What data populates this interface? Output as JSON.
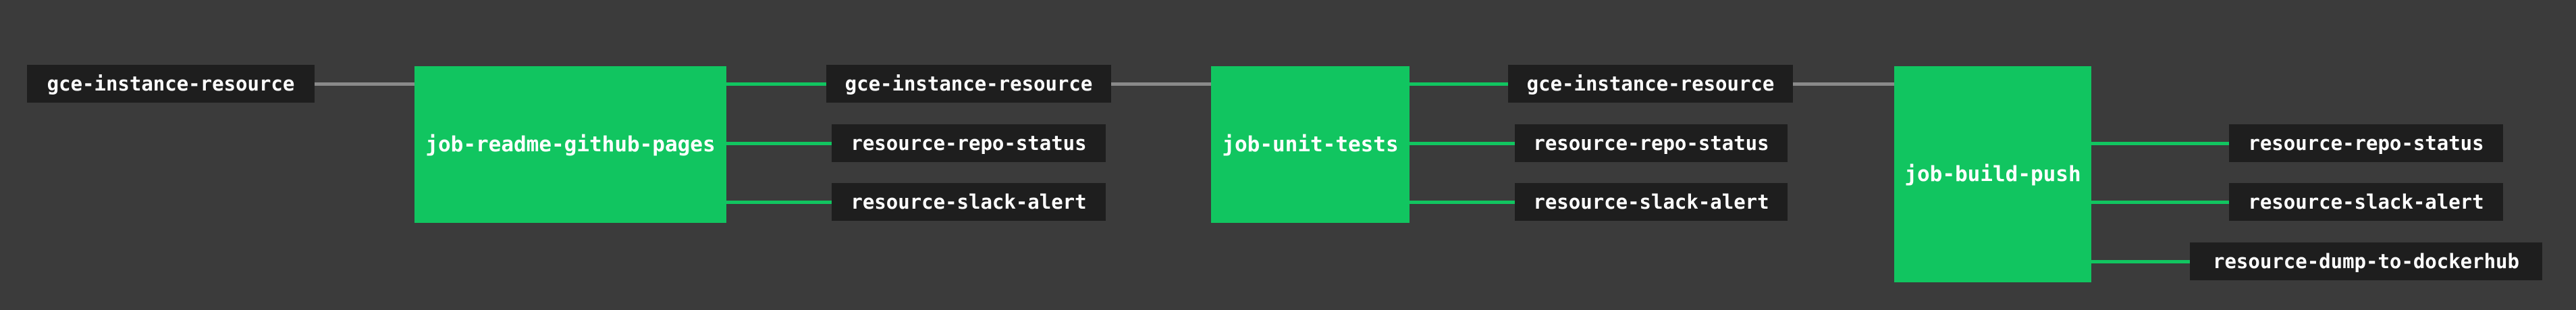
{
  "colors": {
    "background": "#3b3b3b",
    "job_fill": "#11c560",
    "resource_fill": "#1e1e1e",
    "input_edge": "#8a8a8a",
    "output_edge": "#11c560",
    "text": "#ffffff"
  },
  "pipeline": {
    "inputs": [
      {
        "label": "gce-instance-resource",
        "feeds": "job-readme-github-pages"
      }
    ],
    "jobs": [
      {
        "label": "job-readme-github-pages",
        "status": "succeeded",
        "outputs": [
          {
            "label": "gce-instance-resource"
          },
          {
            "label": "resource-repo-status"
          },
          {
            "label": "resource-slack-alert"
          }
        ]
      },
      {
        "label": "job-unit-tests",
        "status": "succeeded",
        "outputs": [
          {
            "label": "gce-instance-resource"
          },
          {
            "label": "resource-repo-status"
          },
          {
            "label": "resource-slack-alert"
          }
        ]
      },
      {
        "label": "job-build-push",
        "status": "succeeded",
        "outputs": [
          {
            "label": "resource-repo-status"
          },
          {
            "label": "resource-slack-alert"
          },
          {
            "label": "resource-dump-to-dockerhub"
          }
        ]
      }
    ]
  }
}
